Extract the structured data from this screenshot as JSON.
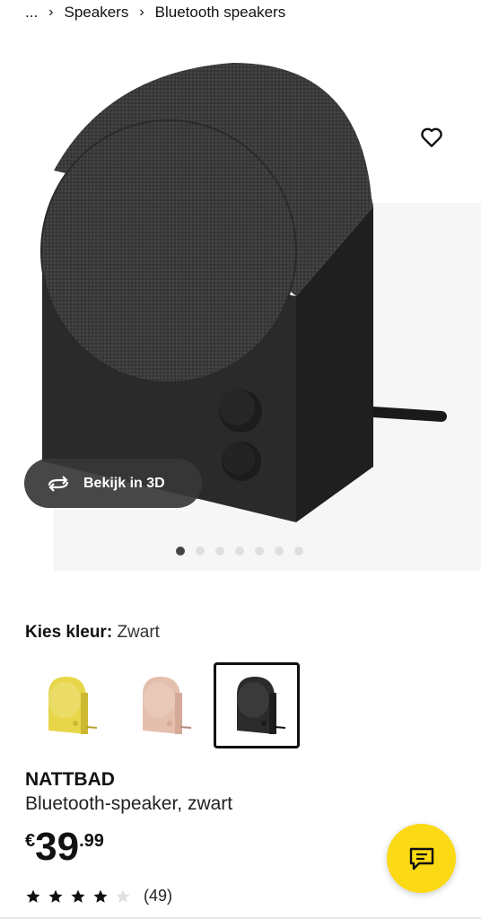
{
  "breadcrumb": {
    "items": [
      "...",
      "Speakers",
      "Bluetooth speakers"
    ],
    "separator": "›"
  },
  "gallery": {
    "favorite_icon": "heart-outline-icon",
    "view_3d_icon": "rotate-3d-icon",
    "view_3d_label": "Bekijk in 3D",
    "image_count": 7,
    "active_index": 0
  },
  "color": {
    "label": "Kies kleur:",
    "selected": "Zwart",
    "options": [
      {
        "name": "geel",
        "hex": "#e8d64a"
      },
      {
        "name": "roze",
        "hex": "#e4bfae"
      },
      {
        "name": "zwart",
        "hex": "#2b2b2b"
      }
    ]
  },
  "product": {
    "name": "NATTBAD",
    "description": "Bluetooth-speaker, zwart"
  },
  "price": {
    "currency": "€",
    "integer": "39",
    "decimal": ".99"
  },
  "rating": {
    "value": 4,
    "max": 5,
    "count_label": "(49)"
  },
  "chat": {
    "icon": "chat-bubble-icon",
    "color": "#fbd914"
  }
}
